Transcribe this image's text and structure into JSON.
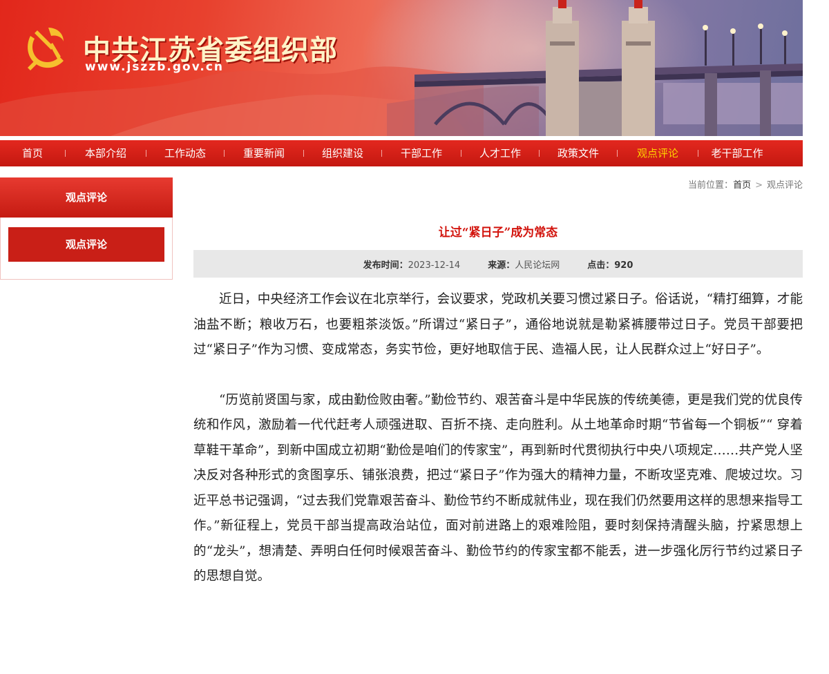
{
  "site": {
    "title": "中共江苏省委组织部",
    "url": "www.jszzb.gov.cn"
  },
  "nav": {
    "items": [
      {
        "label": "首页"
      },
      {
        "label": "本部介绍"
      },
      {
        "label": "工作动态"
      },
      {
        "label": "重要新闻"
      },
      {
        "label": "组织建设"
      },
      {
        "label": "干部工作"
      },
      {
        "label": "人才工作"
      },
      {
        "label": "政策文件"
      },
      {
        "label": "观点评论",
        "active": true
      },
      {
        "label": "老干部工作"
      }
    ]
  },
  "sidebar": {
    "heading": "观点评论",
    "link": "观点评论"
  },
  "breadcrumb": {
    "prefix": "当前位置：",
    "home": "首页",
    "separator": ">",
    "current": "观点评论"
  },
  "article": {
    "title": "让过“紧日子”成为常态",
    "publish_label": "发布时间：",
    "publish_date": "2023-12-14",
    "source_label": "来源：",
    "source": "人民论坛网",
    "clicks_label": "点击：",
    "clicks": "920",
    "paragraphs": [
      "近日，中央经济工作会议在北京举行，会议要求，党政机关要习惯过紧日子。俗话说，“精打细算，才能油盐不断；粮收万石，也要粗茶淡饭。”所谓过“紧日子”，通俗地说就是勒紧裤腰带过日子。党员干部要把过“紧日子”作为习惯、变成常态，务实节俭，更好地取信于民、造福人民，让人民群众过上“好日子”。",
      "“历览前贤国与家，成由勤俭败由奢。”勤俭节约、艰苦奋斗是中华民族的传统美德，更是我们党的优良传统和作风，激励着一代代赶考人顽强进取、百折不挠、走向胜利。从土地革命时期“节省每一个铜板”“ 穿着草鞋干革命”，到新中国成立初期“勤俭是咱们的传家宝”，再到新时代贯彻执行中央八项规定……共产党人坚决反对各种形式的贪图享乐、铺张浪费，把过“紧日子”作为强大的精神力量，不断攻坚克难、爬坡过坎。习近平总书记强调，“过去我们党靠艰苦奋斗、勤俭节约不断成就伟业，现在我们仍然要用这样的思想来指导工作。”新征程上，党员干部当提高政治站位，面对前进路上的艰难险阻，要时刻保持清醒头脑，拧紧思想上的“龙头”，想清楚、弄明白任何时候艰苦奋斗、勤俭节约的传家宝都不能丢，进一步强化厉行节约过紧日子的思想自觉。"
    ]
  },
  "colors": {
    "primary_red": "#c91f17",
    "title_red": "#d2130c",
    "nav_active": "#ffd200",
    "meta_bg": "#e8e8e8"
  },
  "icons": {
    "logo": "hammer-and-sickle-emblem"
  }
}
